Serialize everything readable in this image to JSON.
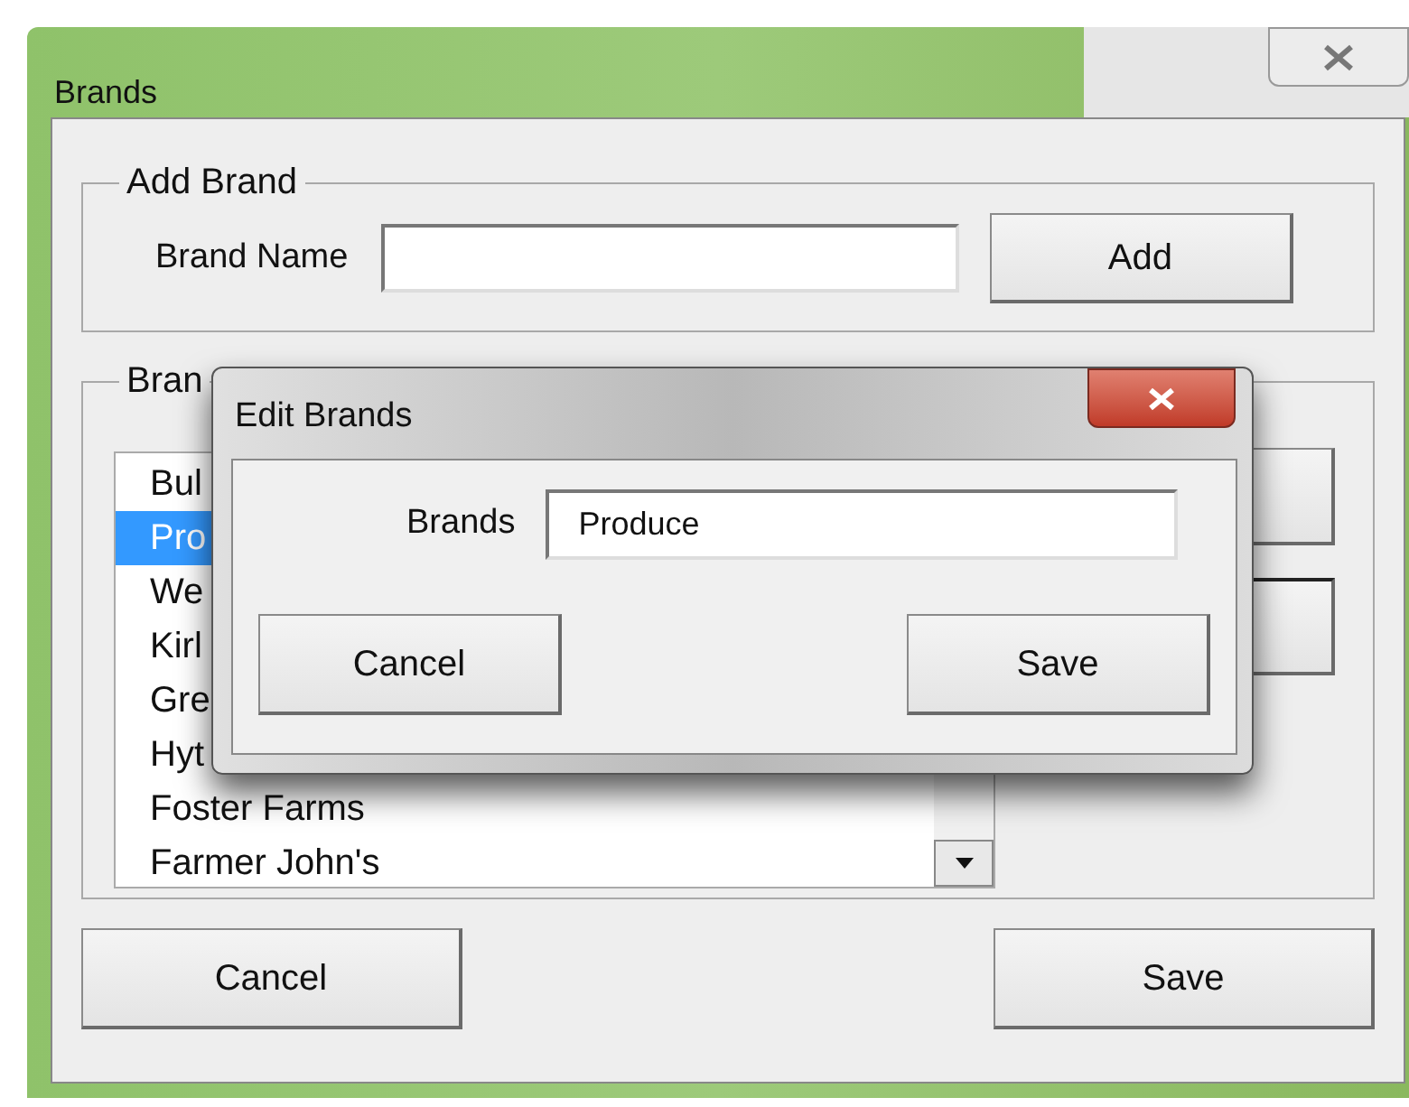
{
  "window": {
    "title": "Brands"
  },
  "add_brand": {
    "legend": "Add Brand",
    "label": "Brand Name",
    "button": "Add"
  },
  "brands_group": {
    "legend": "Bran",
    "items": [
      {
        "text": "Bul",
        "selected": false
      },
      {
        "text": "Pro",
        "selected": true
      },
      {
        "text": "We",
        "selected": false
      },
      {
        "text": "Kirl",
        "selected": false
      },
      {
        "text": "Gre",
        "selected": false
      },
      {
        "text": "Hyt",
        "selected": false
      },
      {
        "text": "Foster Farms",
        "selected": false
      },
      {
        "text": "Farmer John's",
        "selected": false
      }
    ],
    "side_buttons": [
      {
        "default": false
      },
      {
        "default": true
      }
    ]
  },
  "footer_buttons": [
    "Cancel",
    "Save"
  ],
  "dialog": {
    "title": "Edit Brands",
    "label": "Brands",
    "value": "Produce",
    "buttons": [
      "Cancel",
      "Save"
    ]
  }
}
